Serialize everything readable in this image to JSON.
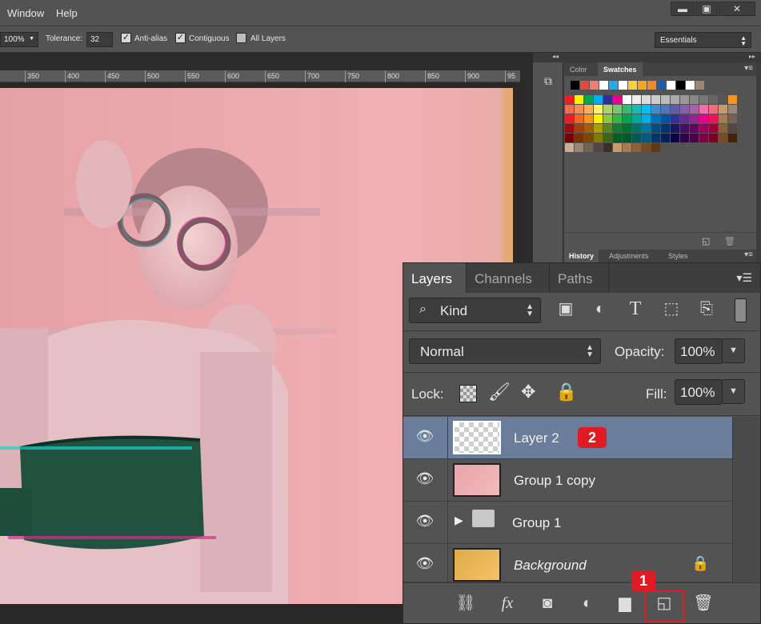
{
  "menubar": {
    "items": [
      "Window",
      "Help"
    ],
    "window_controls": [
      "minimize",
      "restore",
      "close"
    ]
  },
  "options": {
    "zoom": "100%",
    "tolerance_label": "Tolerance:",
    "tolerance_value": "32",
    "anti_alias": "Anti-alias",
    "contiguous": "Contiguous",
    "all_layers": "All Layers",
    "anti_alias_checked": true,
    "contiguous_checked": true,
    "all_layers_checked": false,
    "workspace": "Essentials"
  },
  "ruler": {
    "labels": [
      "350",
      "400",
      "450",
      "500",
      "550",
      "600",
      "650",
      "700",
      "750",
      "800",
      "850",
      "900",
      "95"
    ]
  },
  "swatches_panel": {
    "tabs": [
      "Color",
      "Swatches"
    ],
    "active_tab": "Swatches",
    "colors": {
      "top": [
        "#000000",
        "#e8473a",
        "#f0806b",
        "#ffffff",
        "#25aaf0",
        "#ffffff",
        "#fbd038",
        "#f6a61c",
        "#f08a2c",
        "#1d5ea8",
        "#ffffff",
        "#000000",
        "#ffffff",
        "#a28672"
      ],
      "grid": [
        [
          "#ee1c24",
          "#fff200",
          "#00a651",
          "#00aeef",
          "#2e3192",
          "#ec008c",
          "#ffffff",
          "#eeeeee",
          "#dddddd",
          "#cccccc",
          "#bbbbbb",
          "#aaaaaa",
          "#999999",
          "#888888",
          "#777777",
          "#666666",
          "#555555",
          "#f7941d"
        ],
        [
          "#f26c4f",
          "#f68e56",
          "#fbaf5c",
          "#fff467",
          "#acd372",
          "#7cc576",
          "#3bb878",
          "#1abbb4",
          "#00bff3",
          "#438ccb",
          "#5574b9",
          "#605ca8",
          "#855fa8",
          "#a763a8",
          "#f06ea9",
          "#f26d7d",
          "#c69c6d",
          "#998675"
        ],
        [
          "#ed1c24",
          "#f26522",
          "#f7941d",
          "#fff200",
          "#8dc63f",
          "#39b54a",
          "#00a651",
          "#00a99d",
          "#00aeef",
          "#0072bc",
          "#0054a6",
          "#2e3192",
          "#662d91",
          "#92278f",
          "#ec008c",
          "#ed145b",
          "#a67c52",
          "#736357"
        ],
        [
          "#9e0b0f",
          "#a0410d",
          "#a36209",
          "#aba000",
          "#598527",
          "#1a7b30",
          "#007236",
          "#00746b",
          "#0076a3",
          "#004b80",
          "#003471",
          "#1b1464",
          "#440e62",
          "#630460",
          "#9e005d",
          "#9e0039",
          "#8c6239",
          "#534741"
        ],
        [
          "#790000",
          "#7b2e00",
          "#7d4900",
          "#827b00",
          "#406618",
          "#005e20",
          "#005826",
          "#005952",
          "#005b7f",
          "#003663",
          "#002157",
          "#0d004c",
          "#32004b",
          "#4b0049",
          "#7b0046",
          "#7a0026",
          "#754c24",
          "#42210b"
        ],
        [
          "#c7b299",
          "#998675",
          "#736357",
          "#534741",
          "#37302a",
          "#c69c6d",
          "#a67c52",
          "#8c6239",
          "#754c24",
          "#603913"
        ]
      ]
    }
  },
  "history_tabs": [
    "History",
    "Adjustments",
    "Styles"
  ],
  "layers_panel": {
    "tabs": [
      "Layers",
      "Channels",
      "Paths"
    ],
    "active_tab": "Layers",
    "filter_label": "Kind",
    "blend_mode": "Normal",
    "opacity_label": "Opacity:",
    "opacity_value": "100%",
    "lock_label": "Lock:",
    "fill_label": "Fill:",
    "fill_value": "100%",
    "layers": [
      {
        "name": "Layer 2",
        "selected": true,
        "thumb": "transparent",
        "badge": "2"
      },
      {
        "name": "Group 1 copy",
        "selected": false,
        "thumb": "photo"
      },
      {
        "name": "Group 1",
        "selected": false,
        "thumb": "folder"
      },
      {
        "name": "Background",
        "selected": false,
        "thumb": "gold",
        "locked": true
      }
    ],
    "new_layer_badge": "1"
  }
}
